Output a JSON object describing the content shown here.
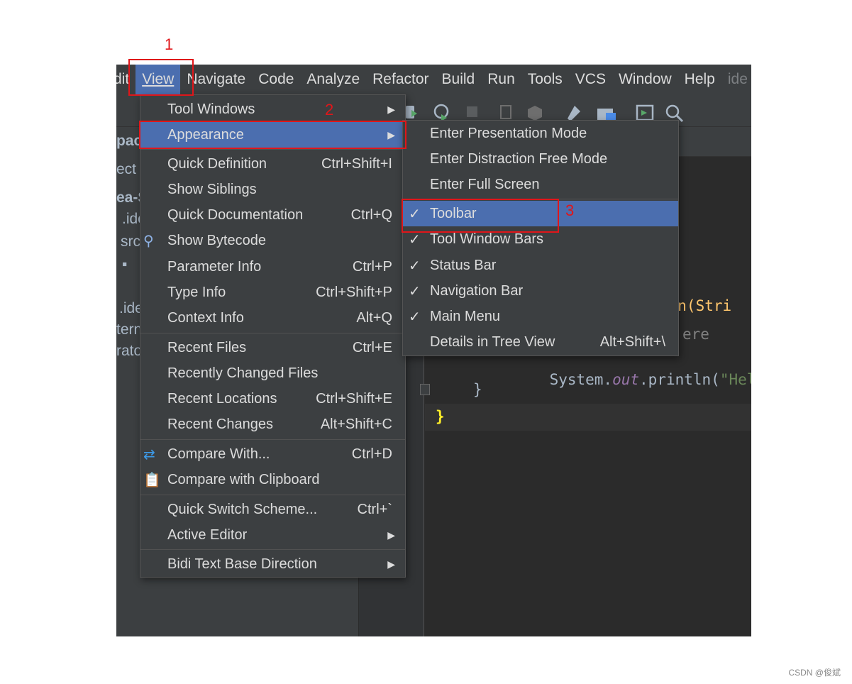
{
  "menubar": {
    "items": [
      "dit",
      "View",
      "Navigate",
      "Code",
      "Analyze",
      "Refactor",
      "Build",
      "Run",
      "Tools",
      "VCS",
      "Window",
      "Help",
      "ide"
    ]
  },
  "project_panel": {
    "items": [
      "pac",
      "ect",
      "ea-S",
      ".ide",
      "src",
      "",
      ".ide",
      "tern",
      "rato"
    ]
  },
  "view_menu": {
    "items": [
      {
        "label": "Tool Windows",
        "shortcut": "",
        "submenu": true
      },
      {
        "label": "Appearance",
        "shortcut": "",
        "submenu": true
      },
      {
        "label": "Quick Definition",
        "shortcut": "Ctrl+Shift+I"
      },
      {
        "label": "Show Siblings",
        "shortcut": ""
      },
      {
        "label": "Quick Documentation",
        "shortcut": "Ctrl+Q"
      },
      {
        "label": "Show Bytecode",
        "shortcut": ""
      },
      {
        "label": "Parameter Info",
        "shortcut": "Ctrl+P"
      },
      {
        "label": "Type Info",
        "shortcut": "Ctrl+Shift+P"
      },
      {
        "label": "Context Info",
        "shortcut": "Alt+Q"
      },
      {
        "label": "Recent Files",
        "shortcut": "Ctrl+E"
      },
      {
        "label": "Recently Changed Files",
        "shortcut": ""
      },
      {
        "label": "Recent Locations",
        "shortcut": "Ctrl+Shift+E"
      },
      {
        "label": "Recent Changes",
        "shortcut": "Alt+Shift+C"
      },
      {
        "label": "Compare With...",
        "shortcut": "Ctrl+D"
      },
      {
        "label": "Compare with Clipboard",
        "shortcut": ""
      },
      {
        "label": "Quick Switch Scheme...",
        "shortcut": "Ctrl+`"
      },
      {
        "label": "Active Editor",
        "shortcut": "",
        "submenu": true
      },
      {
        "label": "Bidi Text Base Direction",
        "shortcut": "",
        "submenu": true
      }
    ]
  },
  "appearance_menu": {
    "items": [
      {
        "label": "Enter Presentation Mode",
        "checked": false,
        "shortcut": ""
      },
      {
        "label": "Enter Distraction Free Mode",
        "checked": false,
        "shortcut": ""
      },
      {
        "label": "Enter Full Screen",
        "checked": false,
        "shortcut": ""
      },
      {
        "label": "Toolbar",
        "checked": true,
        "shortcut": ""
      },
      {
        "label": "Tool Window Bars",
        "checked": true,
        "shortcut": ""
      },
      {
        "label": "Status Bar",
        "checked": true,
        "shortcut": ""
      },
      {
        "label": "Navigation Bar",
        "checked": true,
        "shortcut": ""
      },
      {
        "label": "Main Menu",
        "checked": true,
        "shortcut": ""
      },
      {
        "label": "Details in Tree View",
        "checked": false,
        "shortcut": "Alt+Shift+\\"
      }
    ]
  },
  "editor": {
    "line_main": "ain(Stri",
    "line_comment": "ere",
    "line_print_a": "System.",
    "line_print_b": "out",
    "line_print_c": ".println(",
    "line_print_d": "\"Hell",
    "line_close_inner": "}",
    "line_close_outer": "}"
  },
  "annotations": [
    "1",
    "2",
    "3"
  ],
  "watermark": "CSDN @俊斌",
  "colors": {
    "menu_bg": "#3c3f41",
    "selection": "#4b6eaf",
    "annotation": "#e0161a"
  }
}
